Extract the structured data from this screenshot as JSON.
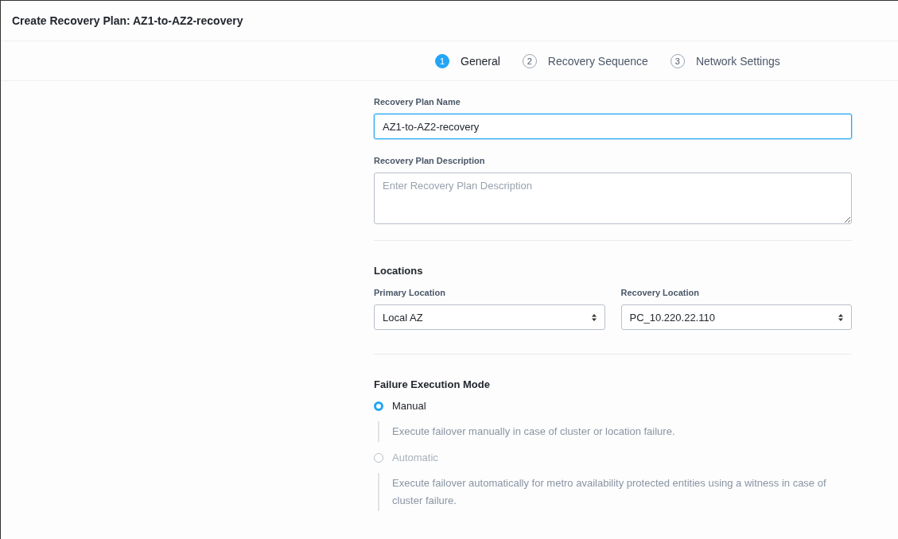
{
  "window": {
    "title": "Create Recovery Plan: AZ1-to-AZ2-recovery"
  },
  "steps": [
    {
      "number": "1",
      "label": "General",
      "selected": true
    },
    {
      "number": "2",
      "label": "Recovery Sequence",
      "selected": false
    },
    {
      "number": "3",
      "label": "Network Settings",
      "selected": false
    }
  ],
  "name_field": {
    "label": "Recovery Plan Name",
    "value": "AZ1-to-AZ2-recovery"
  },
  "description_field": {
    "label": "Recovery Plan Description",
    "placeholder": "Enter Recovery Plan Description"
  },
  "locations": {
    "title": "Locations",
    "selects": [
      {
        "label": "Primary Location",
        "value": "Local AZ"
      },
      {
        "label": "Recovery Location",
        "value": "PC_10.220.22.110"
      }
    ]
  },
  "failure_mode": {
    "title": "Failure Execution Mode",
    "options": [
      {
        "label": "Manual",
        "description": "Execute failover manually in case of cluster or location failure.",
        "selected": true,
        "disabled": false
      },
      {
        "label": "Automatic",
        "description": "Execute failover automatically for metro availability protected entities using a witness in case of cluster failure.",
        "selected": false,
        "disabled": true
      }
    ]
  }
}
